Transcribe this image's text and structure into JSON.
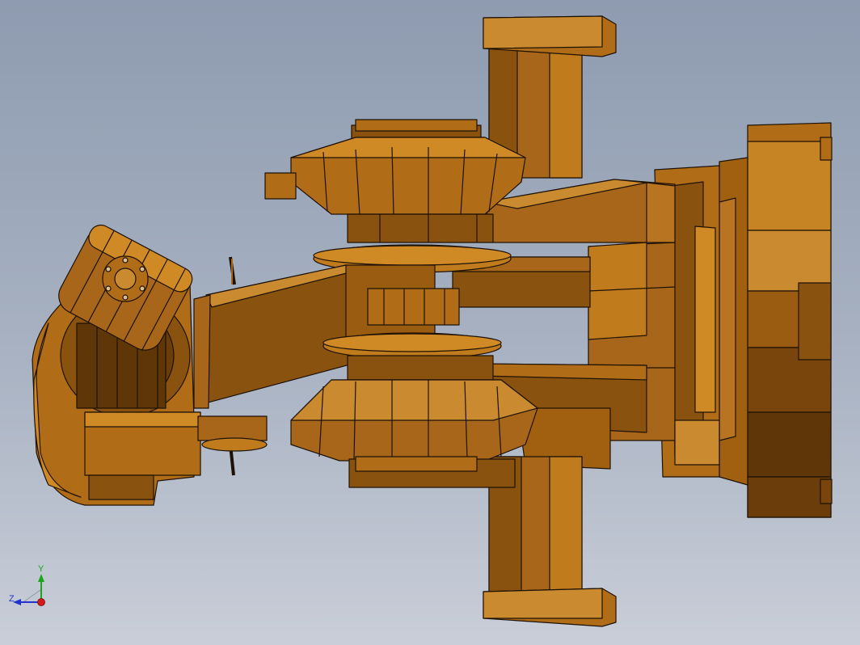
{
  "scene": {
    "model": "robot-arm-cad-model",
    "colors": {
      "part_base": "#b06c16",
      "part_light": "#cf8a26",
      "part_dark": "#5e3608",
      "part_mid": "#8a520f",
      "edge": "#1e1206",
      "background_top": "#8e9bb0",
      "background_bottom": "#c9ced8"
    }
  },
  "triad": {
    "y_label": "Y",
    "z_label": "Z",
    "colors": {
      "x": "#d11a1a",
      "y": "#1aa51a",
      "z": "#2233cc"
    }
  }
}
